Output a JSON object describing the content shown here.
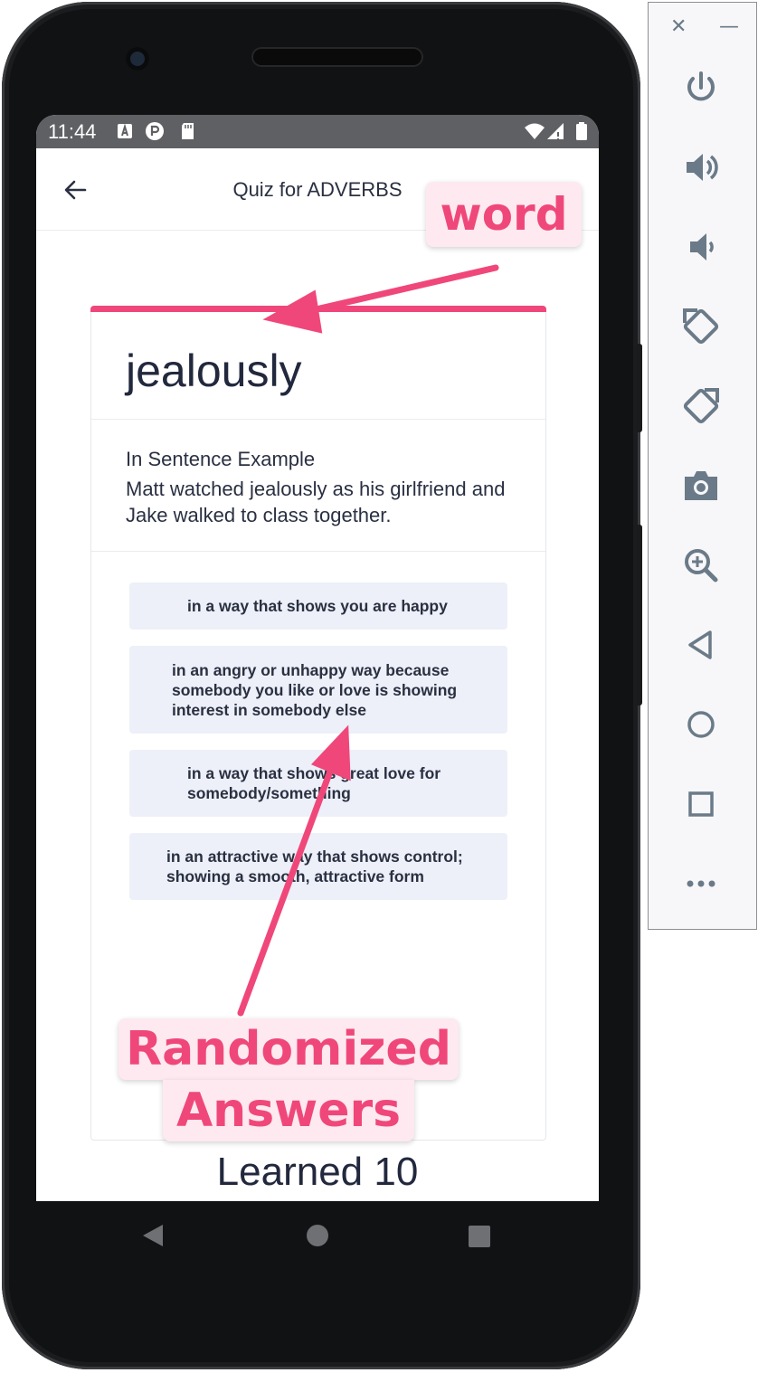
{
  "status_bar": {
    "time": "11:44"
  },
  "app_bar": {
    "title": "Quiz for ADVERBS"
  },
  "card": {
    "word": "jealously",
    "example_label": "In Sentence Example",
    "example_text": "Matt watched jealously as his girlfriend and Jake walked to class together.",
    "answers": [
      {
        "text": "in a way that shows you are happy"
      },
      {
        "text": "in an angry or unhappy way because somebody you like or love is showing interest in somebody else"
      },
      {
        "text": "in a way that shows great love for somebody/something"
      },
      {
        "text": "in an attractive way that shows control; showing a smooth, attractive form"
      }
    ]
  },
  "footer": {
    "learned": "Learned 10"
  },
  "annotations": {
    "word_label": "word",
    "answers_label_line1": "Randomized",
    "answers_label_line2": "Answers",
    "color": "#f0477a"
  },
  "emulator_toolbar": {
    "buttons": [
      "power-icon",
      "volume-up-icon",
      "volume-down-icon",
      "rotate-left-icon",
      "rotate-right-icon",
      "camera-icon",
      "zoom-icon",
      "back-icon",
      "home-icon",
      "overview-icon",
      "more-icon"
    ]
  }
}
